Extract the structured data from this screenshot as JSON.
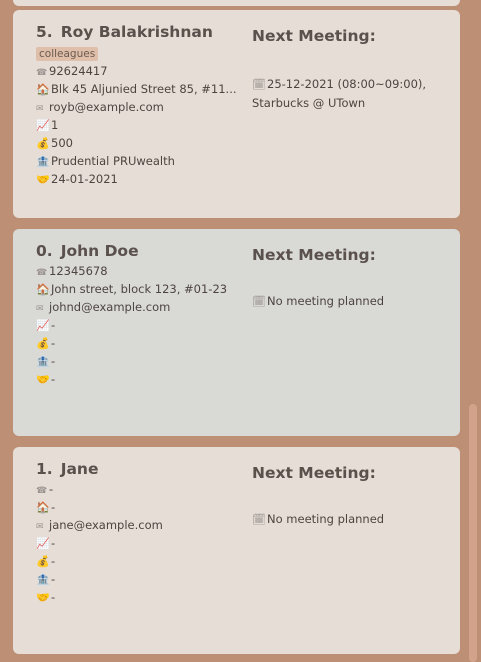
{
  "icons": {
    "phone": "☎",
    "address": "🏠",
    "email": "✉",
    "chart": "📈",
    "money": "💰",
    "bank": "🏦",
    "handshake": "🤝",
    "meeting": "🗓"
  },
  "meeting_title": "Next Meeting:",
  "persons": [
    {
      "index": "5.",
      "name": "Roy Balakrishnan",
      "tag": "colleagues",
      "phone": "92624417",
      "address": "Blk 45 Aljunied Street 85, #11...",
      "email": "royb@example.com",
      "risk": "1",
      "income": "500",
      "policy": "Prudential PRUwealth",
      "last_met": "24-01-2021",
      "meeting": "25-12-2021 (08:00~09:00), Starbucks @ UTown"
    },
    {
      "index": "0.",
      "name": "John Doe",
      "phone": "12345678",
      "address": "John street, block 123, #01-23",
      "email": "johnd@example.com",
      "risk": "-",
      "income": "-",
      "policy": "-",
      "last_met": "-",
      "meeting": "No meeting planned"
    },
    {
      "index": "1.",
      "name": "Jane",
      "phone": "-",
      "address": "-",
      "email": "jane@example.com",
      "risk": "-",
      "income": "-",
      "policy": "-",
      "last_met": "-",
      "meeting": "No meeting planned"
    }
  ],
  "colors": {
    "background": "#bd8f74",
    "card_beige": "#e6ddd6",
    "card_selected": "#d9d9d6",
    "tag": "#dfbfa9",
    "scrollbar": "#d2a28a"
  }
}
